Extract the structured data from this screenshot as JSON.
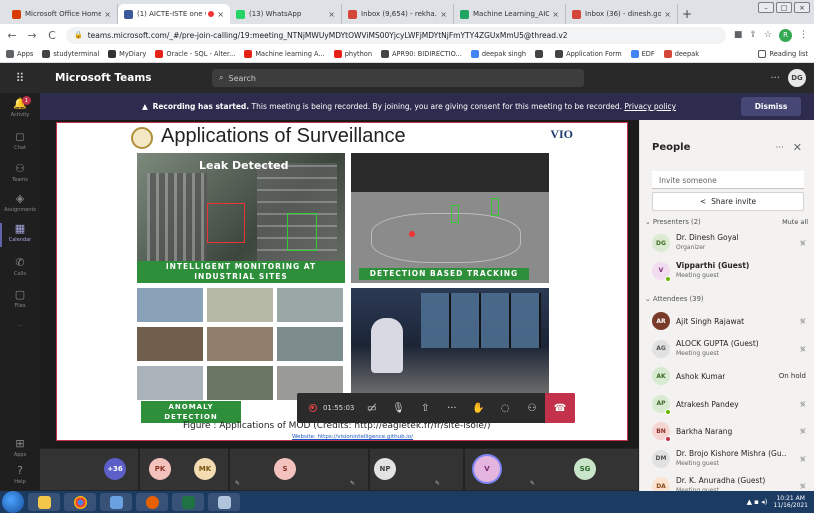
{
  "browser": {
    "tabs": [
      {
        "title": "Microsoft Office Home",
        "color": "#d83b01"
      },
      {
        "title": "(1) AICTE-ISTE one we",
        "color": "#3c5a99",
        "active": true,
        "recording": true
      },
      {
        "title": "(13) WhatsApp",
        "color": "#25d366"
      },
      {
        "title": "Inbox (9,654) - rekha.jain@",
        "color": "#d44638"
      },
      {
        "title": "Machine Learning_AICTE-I",
        "color": "#1fa463"
      },
      {
        "title": "Inbox (36) - dinesh.goyal@",
        "color": "#d44638"
      }
    ],
    "new_tab": "+",
    "url": "teams.microsoft.com/_#/pre-join-calling/19:meeting_NTNjMWUyMDYtOWViMS00YjcyLWFjMDYtNjFmYTY4ZGUxMmU5@thread.v2",
    "profile_initial": "R",
    "bookmarks": [
      {
        "label": "Apps",
        "color": "#5f6368"
      },
      {
        "label": "studyterminal",
        "color": "#444"
      },
      {
        "label": "MyDiary",
        "color": "#333"
      },
      {
        "label": "Oracle - SQL - Alter...",
        "color": "#e62117"
      },
      {
        "label": "Machine learning A...",
        "color": "#e62117"
      },
      {
        "label": "phython",
        "color": "#e62117"
      },
      {
        "label": "APR90: BIDIRECTIO...",
        "color": "#444"
      },
      {
        "label": "deepak singh",
        "color": "#4285f4"
      },
      {
        "label": "",
        "color": "#444"
      },
      {
        "label": "Application Form",
        "color": "#444"
      },
      {
        "label": "EDF",
        "color": "#4285f4"
      },
      {
        "label": "deepak",
        "color": "#d44638"
      }
    ],
    "reading_list": "Reading list"
  },
  "teams": {
    "app_name": "Microsoft Teams",
    "search_placeholder": "Search",
    "more": "···",
    "me_initials": "DG",
    "rail": [
      {
        "label": "Activity",
        "icon": "bell-icon",
        "badge": "1"
      },
      {
        "label": "Chat",
        "icon": "chat-icon"
      },
      {
        "label": "Teams",
        "icon": "teams-icon"
      },
      {
        "label": "Assignments",
        "icon": "assignments-icon"
      },
      {
        "label": "Calendar",
        "icon": "calendar-icon",
        "active": true
      },
      {
        "label": "Calls",
        "icon": "phone-icon"
      },
      {
        "label": "Files",
        "icon": "files-icon"
      },
      {
        "label": "···",
        "icon": "more-icon"
      },
      {
        "label": "Apps",
        "icon": "apps-icon"
      },
      {
        "label": "Help",
        "icon": "help-icon"
      }
    ],
    "banner": {
      "bold": "Recording has started.",
      "text": " This meeting is being recorded. By joining, you are giving consent for this meeting to be recorded. ",
      "link": "Privacy policy",
      "dismiss": "Dismiss"
    }
  },
  "slide": {
    "title": "Applications of Surveillance",
    "leak_label": "Leak Detected",
    "captions": [
      "INTELLIGENT MONITORING AT INDUSTRIAL SITES",
      "DETECTION BASED TRACKING",
      "ANOMALY DETECTION"
    ],
    "figure_caption": "Figure : Applications of MOD (Credits: http://eagletek.fr/fr/site-isole/)",
    "figure_link": "Website: https://visionintelligence.github.io/",
    "brand": "VIO"
  },
  "callbar": {
    "timer": "01:55:03"
  },
  "gallery": [
    {
      "initials": "+36",
      "bg": "#5b5fc7",
      "fg": "#fff"
    },
    {
      "initials": "PK",
      "bg": "#f4c2bc",
      "fg": "#8a2f26"
    },
    {
      "initials": "MK",
      "bg": "#f3dcb1",
      "fg": "#7a5412"
    },
    {
      "initials": "S",
      "bg": "#f4c2bc",
      "fg": "#8a2f26"
    },
    {
      "initials": "NP",
      "bg": "#e3e3e3",
      "fg": "#444"
    },
    {
      "initials": "V",
      "bg": "#e3b5df",
      "fg": "#7b2a72"
    },
    {
      "initials": "SG",
      "bg": "#c9e5c9",
      "fg": "#2d6a2d"
    }
  ],
  "people": {
    "title": "People",
    "invite_placeholder": "Invite someone",
    "share_invite": "Share invite",
    "presenters_label": "Presenters (2)",
    "mute_all": "Mute all",
    "attendees_label": "Attendees (39)",
    "presenters": [
      {
        "initials": "DG",
        "name": "Dr. Dinesh Goyal",
        "sub": "Organizer",
        "bg": "#dbead0",
        "fg": "#3f6a2a"
      },
      {
        "initials": "V",
        "name": "Vipparthi (Guest)",
        "sub": "Meeting guest",
        "bg": "#f2dcf0",
        "fg": "#7b2a72",
        "bold": true,
        "dot": "#6bb700"
      }
    ],
    "attendees": [
      {
        "initials": "AR",
        "name": "Ajit Singh Rajawat",
        "sub": "",
        "bg": "#7a3a2a",
        "fg": "#fff"
      },
      {
        "initials": "AG",
        "name": "ALOCK GUPTA (Guest)",
        "sub": "Meeting guest",
        "bg": "#e1e1e1",
        "fg": "#555"
      },
      {
        "initials": "AK",
        "name": "Ashok Kumar",
        "sub": "",
        "bg": "#d9ead3",
        "fg": "#3f6a2a",
        "status": "On hold"
      },
      {
        "initials": "AP",
        "name": "Atrakesh Pandey",
        "sub": "",
        "bg": "#d9ead3",
        "fg": "#3f6a2a",
        "dot": "#6bb700"
      },
      {
        "initials": "BN",
        "name": "Barkha Narang",
        "sub": "",
        "bg": "#f6d6d3",
        "fg": "#8a2f26",
        "dot": "#c4314b"
      },
      {
        "initials": "DM",
        "name": "Dr. Brojo Kishore Mishra (Gu...",
        "sub": "Meeting guest",
        "bg": "#e1e1e1",
        "fg": "#555"
      },
      {
        "initials": "DA",
        "name": "Dr. K. Anuradha (Guest)",
        "sub": "Meeting guest",
        "bg": "#fbe3d0",
        "fg": "#8a4b1a"
      }
    ]
  },
  "taskbar": {
    "time": "10:21 AM",
    "date": "11/16/2021"
  }
}
